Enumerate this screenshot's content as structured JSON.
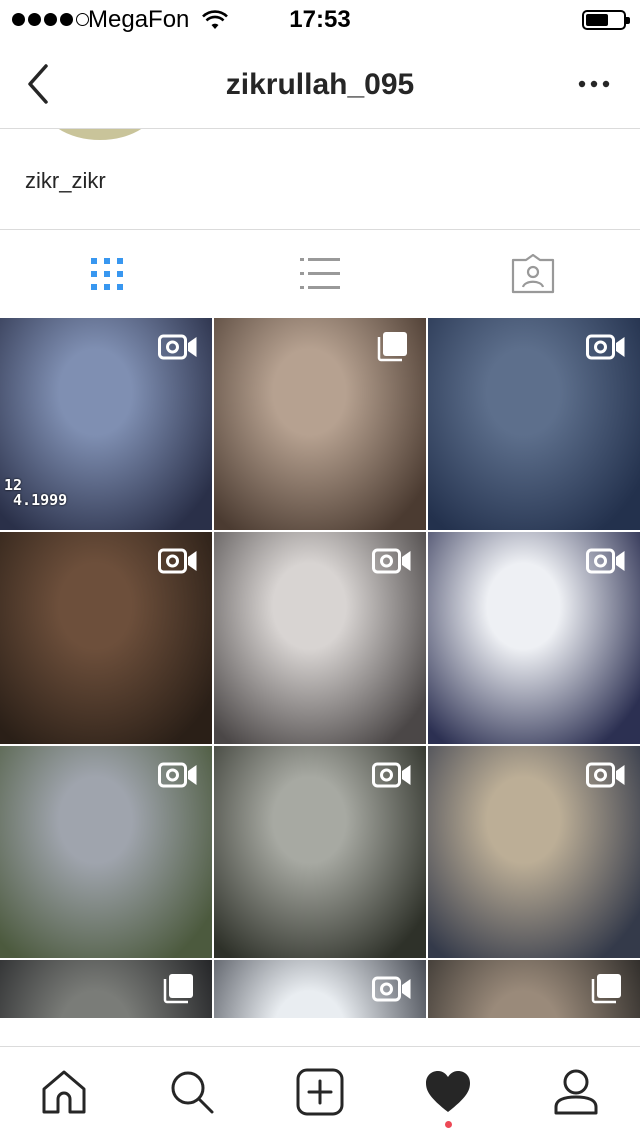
{
  "status_bar": {
    "carrier": "MegaFon",
    "time": "17:53",
    "signal_bars_filled": 4,
    "signal_bars_total": 5,
    "battery_level": 0.55
  },
  "nav": {
    "title": "zikrullah_095",
    "back_icon": "chevron-left-icon",
    "more_icon": "ellipsis-icon"
  },
  "profile": {
    "bio_name": "zikr_zikr"
  },
  "tabs": [
    {
      "id": "grid",
      "icon": "grid-icon",
      "active": true
    },
    {
      "id": "list",
      "icon": "list-icon",
      "active": false
    },
    {
      "id": "tagged",
      "icon": "tagged-photos-icon",
      "active": false
    }
  ],
  "grid": {
    "tiles": [
      {
        "overlay": "video-icon",
        "stamp": "12\n 4.1999",
        "palette": [
          "#7f8fb2",
          "#2a3049"
        ]
      },
      {
        "overlay": "carousel-icon",
        "palette": [
          "#b6a190",
          "#4b3b31"
        ]
      },
      {
        "overlay": "video-icon",
        "palette": [
          "#5d6f8c",
          "#23314d"
        ]
      },
      {
        "overlay": "video-icon",
        "palette": [
          "#6d4f3b",
          "#2a1f17"
        ]
      },
      {
        "overlay": "video-icon",
        "palette": [
          "#d8d4d2",
          "#4b4747"
        ]
      },
      {
        "overlay": "video-icon",
        "palette": [
          "#eef0f4",
          "#2c3052"
        ]
      },
      {
        "overlay": "video-icon",
        "palette": [
          "#9fa4ad",
          "#4c5a3e"
        ]
      },
      {
        "overlay": "video-icon",
        "palette": [
          "#a7a9a2",
          "#2e3129"
        ]
      },
      {
        "overlay": "video-icon",
        "palette": [
          "#bcae96",
          "#343a4a"
        ]
      },
      {
        "overlay": "carousel-icon",
        "palette": [
          "#7a7c78",
          "#1e1f22"
        ]
      },
      {
        "overlay": "video-icon",
        "palette": [
          "#e9edf1",
          "#3b3f48"
        ]
      },
      {
        "overlay": "carousel-icon",
        "palette": [
          "#9a8a7a",
          "#2a2826"
        ]
      }
    ]
  },
  "bottom_bar": {
    "items": [
      {
        "id": "home",
        "icon": "home-icon",
        "active": false
      },
      {
        "id": "search",
        "icon": "search-icon",
        "active": false
      },
      {
        "id": "new-post",
        "icon": "plus-square-icon",
        "active": false
      },
      {
        "id": "activity",
        "icon": "heart-icon",
        "active": true
      },
      {
        "id": "profile",
        "icon": "profile-icon",
        "active": false
      }
    ]
  },
  "colors": {
    "accent_blue": "#3897f0",
    "inactive_icon": "#999999",
    "notification_red": "#ed4956",
    "separator": "#dbdbdb"
  }
}
